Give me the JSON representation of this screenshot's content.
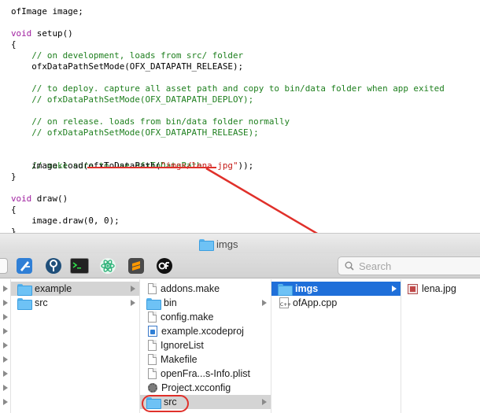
{
  "code_lines": [
    {
      "indent": "",
      "parts": [
        {
          "t": "ofImage image;",
          "k": ""
        }
      ]
    },
    {
      "indent": "",
      "parts": []
    },
    {
      "indent": "",
      "parts": [
        {
          "t": "void",
          "k": "kw"
        },
        {
          "t": " setup()",
          "k": ""
        }
      ]
    },
    {
      "indent": "",
      "parts": [
        {
          "t": "{",
          "k": ""
        }
      ]
    },
    {
      "indent": "    ",
      "parts": [
        {
          "t": "// on development, loads from src/ folder",
          "k": "com"
        }
      ]
    },
    {
      "indent": "    ",
      "parts": [
        {
          "t": "ofxDataPathSetMode(OFX_DATAPATH_RELEASE);",
          "k": ""
        }
      ]
    },
    {
      "indent": "",
      "parts": []
    },
    {
      "indent": "    ",
      "parts": [
        {
          "t": "// to deploy. capture all asset path and copy to bin/data folder when app exited",
          "k": "com"
        }
      ]
    },
    {
      "indent": "    ",
      "parts": [
        {
          "t": "// ofxDataPathSetMode(OFX_DATAPATH_DEPLOY);",
          "k": "com"
        }
      ]
    },
    {
      "indent": "",
      "parts": []
    },
    {
      "indent": "    ",
      "parts": [
        {
          "t": "// on release. loads from bin/data folder normally",
          "k": "com"
        }
      ]
    },
    {
      "indent": "    ",
      "parts": [
        {
          "t": "// ofxDataPathSetMode(OFX_DATAPATH_RELEASE);",
          "k": "com"
        }
      ]
    },
    {
      "indent": "",
      "parts": []
    },
    {
      "indent": "",
      "parts": []
    },
    {
      "indent": "    ",
      "parts": [
        {
          "t": "// make sure to use ofxToDataPath",
          "k": "com"
        }
      ]
    },
    {
      "indent": "    ",
      "parts": [
        {
          "t": "image.load(ofxToDataPath(",
          "k": ""
        },
        {
          "t": "\"imgs/lena.jpg\"",
          "k": "str"
        },
        {
          "t": "));",
          "k": ""
        }
      ]
    },
    {
      "indent": "",
      "parts": [
        {
          "t": "}",
          "k": ""
        }
      ]
    },
    {
      "indent": "",
      "parts": []
    },
    {
      "indent": "",
      "parts": [
        {
          "t": "void",
          "k": "kw"
        },
        {
          "t": " draw()",
          "k": ""
        }
      ]
    },
    {
      "indent": "",
      "parts": [
        {
          "t": "{",
          "k": ""
        }
      ]
    },
    {
      "indent": "    ",
      "parts": [
        {
          "t": "image.draw(0, 0);",
          "k": ""
        }
      ]
    },
    {
      "indent": "",
      "parts": [
        {
          "t": "}",
          "k": ""
        }
      ]
    }
  ],
  "finder": {
    "title": "imgs",
    "search_placeholder": "Search",
    "toolbar_icons": [
      "xcode-icon",
      "sourcetree-icon",
      "terminal-icon",
      "atom-icon",
      "sublime-text-icon",
      "openframeworks-icon"
    ],
    "column1": [
      {
        "name": "example",
        "icon": "folder",
        "selected": "grey",
        "has_children": true
      },
      {
        "name": "src",
        "icon": "folder",
        "selected": "",
        "has_children": true
      }
    ],
    "column2": [
      {
        "name": "addons.make",
        "icon": "doc",
        "selected": "",
        "has_children": false
      },
      {
        "name": "bin",
        "icon": "folder",
        "selected": "",
        "has_children": true
      },
      {
        "name": "config.make",
        "icon": "doc",
        "selected": "",
        "has_children": false
      },
      {
        "name": "example.xcodeproj",
        "icon": "xcode",
        "selected": "",
        "has_children": false
      },
      {
        "name": "IgnoreList",
        "icon": "doc",
        "selected": "",
        "has_children": false
      },
      {
        "name": "Makefile",
        "icon": "doc",
        "selected": "",
        "has_children": false
      },
      {
        "name": "openFra...s-Info.plist",
        "icon": "doc",
        "selected": "",
        "has_children": false
      },
      {
        "name": "Project.xcconfig",
        "icon": "gear",
        "selected": "",
        "has_children": false
      },
      {
        "name": "src",
        "icon": "folder",
        "selected": "grey",
        "has_children": true
      }
    ],
    "column3": [
      {
        "name": "imgs",
        "icon": "folder",
        "selected": "blue",
        "has_children": true
      },
      {
        "name": "ofApp.cpp",
        "icon": "cpp",
        "selected": "",
        "has_children": false
      }
    ],
    "column4": [
      {
        "name": "lena.jpg",
        "icon": "jpg",
        "selected": "",
        "has_children": false
      }
    ],
    "cpp_icon_label": "C++"
  },
  "colors": {
    "annotation_red": "#e0302a",
    "selection_blue": "#1f6fd9",
    "comment_green": "#1e7f1e",
    "keyword_purple": "#a021a0",
    "string_red": "#c41a16"
  }
}
